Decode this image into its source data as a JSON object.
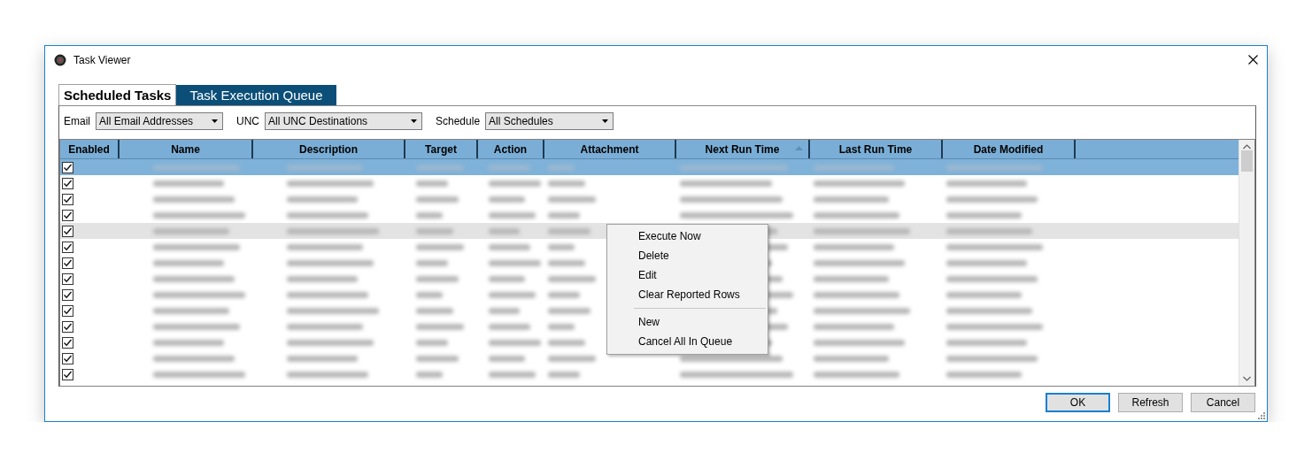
{
  "window": {
    "title": "Task Viewer"
  },
  "tabs": [
    {
      "label": "Scheduled Tasks",
      "selected": true
    },
    {
      "label": "Task Execution Queue",
      "selected": false
    }
  ],
  "filters": [
    {
      "label": "Email",
      "value": "All Email Addresses"
    },
    {
      "label": "UNC",
      "value": "All UNC Destinations"
    },
    {
      "label": "Schedule",
      "value": "All Schedules"
    }
  ],
  "table": {
    "columns": [
      {
        "label": "Enabled",
        "sorted": false
      },
      {
        "label": "Name",
        "sorted": false
      },
      {
        "label": "Description",
        "sorted": false
      },
      {
        "label": "Target",
        "sorted": false
      },
      {
        "label": "Action",
        "sorted": false
      },
      {
        "label": "Attachment",
        "sorted": false
      },
      {
        "label": "Next Run Time",
        "sorted": true
      },
      {
        "label": "Last Run Time",
        "sorted": false
      },
      {
        "label": "Date Modified",
        "sorted": false
      }
    ],
    "rows": [
      {
        "enabled": true,
        "selected": true,
        "hovered": false
      },
      {
        "enabled": true,
        "selected": false,
        "hovered": false
      },
      {
        "enabled": true,
        "selected": false,
        "hovered": false
      },
      {
        "enabled": true,
        "selected": false,
        "hovered": false
      },
      {
        "enabled": true,
        "selected": false,
        "hovered": true
      },
      {
        "enabled": true,
        "selected": false,
        "hovered": false
      },
      {
        "enabled": true,
        "selected": false,
        "hovered": false
      },
      {
        "enabled": true,
        "selected": false,
        "hovered": false
      },
      {
        "enabled": true,
        "selected": false,
        "hovered": false
      },
      {
        "enabled": true,
        "selected": false,
        "hovered": false
      },
      {
        "enabled": true,
        "selected": false,
        "hovered": false
      },
      {
        "enabled": true,
        "selected": false,
        "hovered": false
      },
      {
        "enabled": true,
        "selected": false,
        "hovered": false
      },
      {
        "enabled": true,
        "selected": false,
        "hovered": false
      }
    ]
  },
  "context_menu": {
    "items": [
      {
        "kind": "item",
        "label": "Execute Now"
      },
      {
        "kind": "item",
        "label": "Delete"
      },
      {
        "kind": "item",
        "label": "Edit"
      },
      {
        "kind": "item",
        "label": "Clear Reported Rows"
      },
      {
        "kind": "separator"
      },
      {
        "kind": "item",
        "label": "New"
      },
      {
        "kind": "item",
        "label": "Cancel All In Queue"
      }
    ]
  },
  "buttons": [
    {
      "label": "OK",
      "default": true
    },
    {
      "label": "Refresh",
      "default": false
    },
    {
      "label": "Cancel",
      "default": false
    }
  ]
}
